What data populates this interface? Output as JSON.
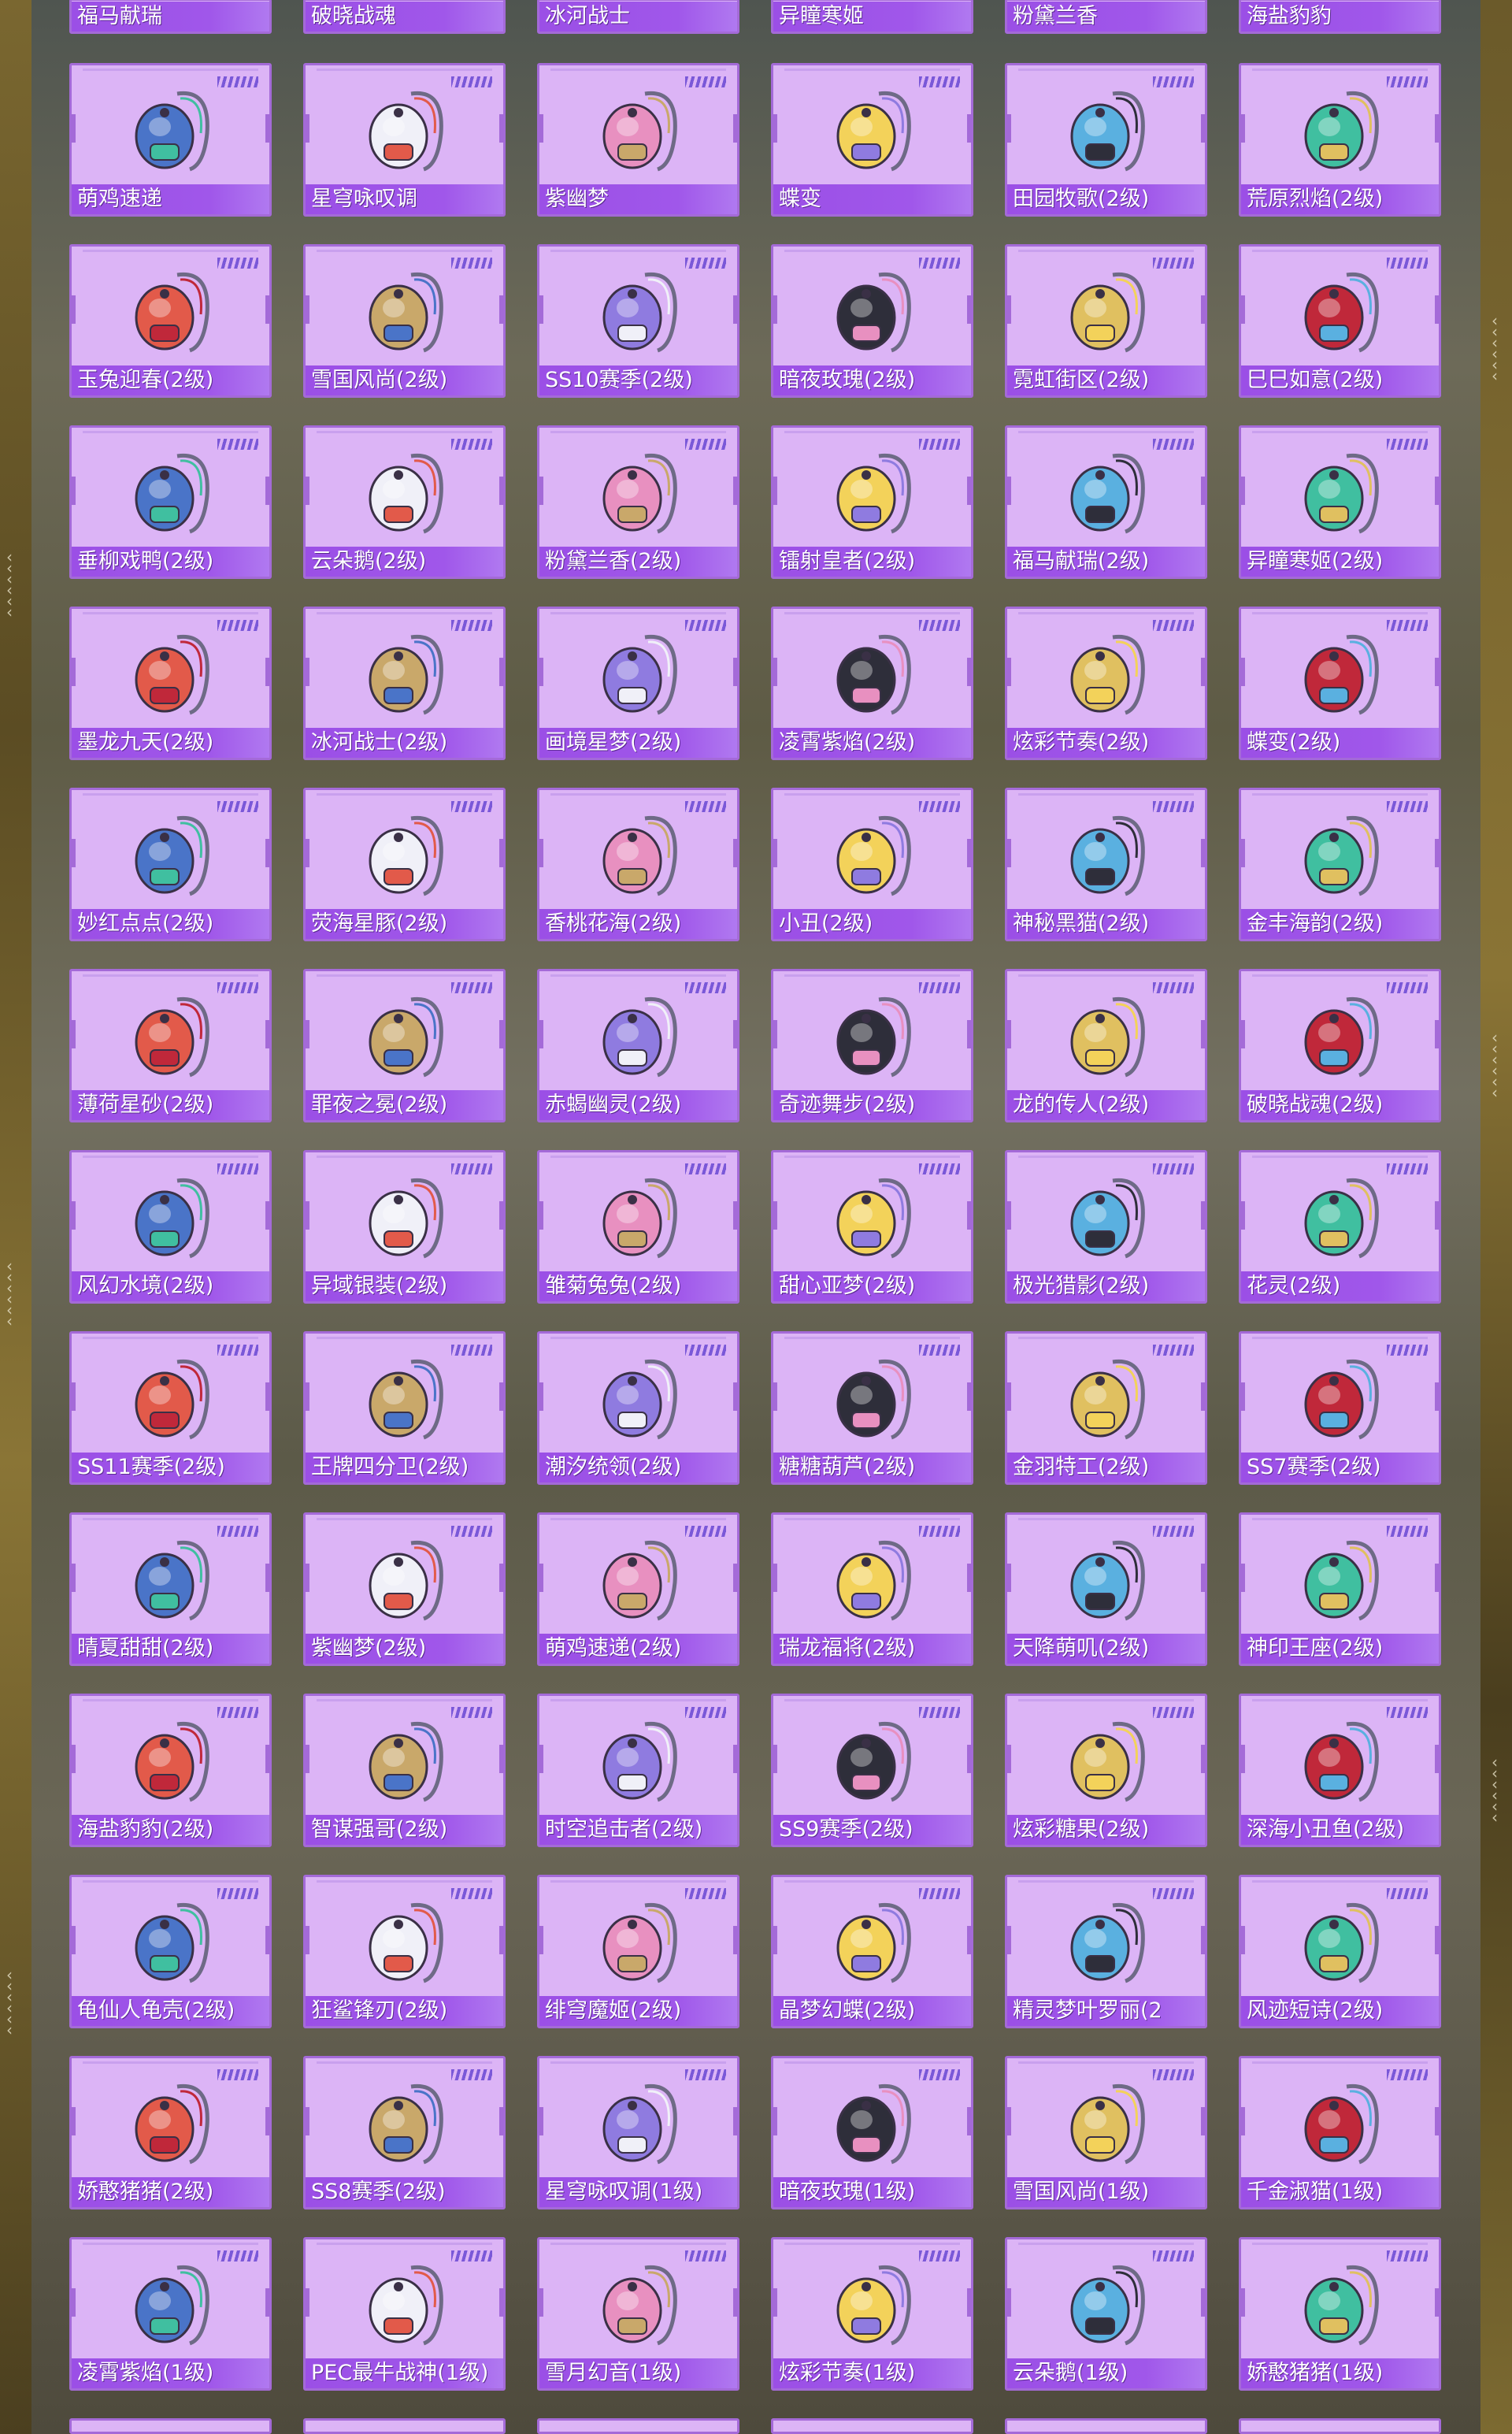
{
  "grid": {
    "rows": [
      [
        "福马献瑞",
        "破晓战魂",
        "冰河战士",
        "异瞳寒姬",
        "粉黛兰香",
        "海盐豹豹"
      ],
      [
        "萌鸡速递",
        "星穹咏叹调",
        "紫幽梦",
        "蝶变",
        "田园牧歌(2级)",
        "荒原烈焰(2级)"
      ],
      [
        "玉兔迎春(2级)",
        "雪国风尚(2级)",
        "SS10赛季(2级)",
        "暗夜玫瑰(2级)",
        "霓虹街区(2级)",
        "巳巳如意(2级)"
      ],
      [
        "垂柳戏鸭(2级)",
        "云朵鹅(2级)",
        "粉黛兰香(2级)",
        "镭射皇者(2级)",
        "福马献瑞(2级)",
        "异瞳寒姬(2级)"
      ],
      [
        "墨龙九天(2级)",
        "冰河战士(2级)",
        "画境星梦(2级)",
        "凌霄紫焰(2级)",
        "炫彩节奏(2级)",
        "蝶变(2级)"
      ],
      [
        "妙红点点(2级)",
        "荧海星豚(2级)",
        "香桃花海(2级)",
        "小丑(2级)",
        "神秘黑猫(2级)",
        "金丰海韵(2级)"
      ],
      [
        "薄荷星砂(2级)",
        "罪夜之冕(2级)",
        "赤蝎幽灵(2级)",
        "奇迹舞步(2级)",
        "龙的传人(2级)",
        "破晓战魂(2级)"
      ],
      [
        "风幻水境(2级)",
        "异域银装(2级)",
        "雏菊兔兔(2级)",
        "甜心亚梦(2级)",
        "极光猎影(2级)",
        "花灵(2级)"
      ],
      [
        "SS11赛季(2级)",
        "王牌四分卫(2级)",
        "潮汐统领(2级)",
        "糖糖葫芦(2级)",
        "金羽特工(2级)",
        "SS7赛季(2级)"
      ],
      [
        "晴夏甜甜(2级)",
        "紫幽梦(2级)",
        "萌鸡速递(2级)",
        "瑞龙福将(2级)",
        "天降萌叽(2级)",
        "神印王座(2级)"
      ],
      [
        "海盐豹豹(2级)",
        "智谋强哥(2级)",
        "时空追击者(2级)",
        "SS9赛季(2级)",
        "炫彩糖果(2级)",
        "深海小丑鱼(2级)"
      ],
      [
        "龟仙人龟壳(2级)",
        "狂鲨锋刃(2级)",
        "绯穹魔姬(2级)",
        "晶梦幻蝶(2级)",
        "精灵梦叶罗丽(2",
        "风迹短诗(2级)"
      ],
      [
        "娇憨猪猪(2级)",
        "SS8赛季(2级)",
        "星穹咏叹调(1级)",
        "暗夜玫瑰(1级)",
        "雪国风尚(1级)",
        "千金淑猫(1级)"
      ],
      [
        "凌霄紫焰(1级)",
        "PEC最牛战神(1级)",
        "雪月幻音(1级)",
        "炫彩节奏(1级)",
        "云朵鹅(1级)",
        "娇憨猪猪(1级)"
      ]
    ],
    "icons": [
      [
        "backpack-icon",
        "backpack-icon",
        "backpack-icon",
        "backpack-icon",
        "backpack-icon",
        "backpack-icon"
      ],
      [
        "chick-backpack-icon",
        "ornate-backpack-icon",
        "purple-orb-backpack-icon",
        "black-bow-backpack-icon",
        "basket-backpack-icon",
        "red-fox-backpack-icon"
      ],
      [
        "red-backpack-icon",
        "white-bunny-backpack-icon",
        "denim-backpack-icon",
        "bunny-doll-backpack-icon",
        "pink-backpack-icon",
        "white-snake-backpack-icon"
      ],
      [
        "duck-backpack-icon",
        "cloud-goose-backpack-icon",
        "pink-bag-backpack-icon",
        "laser-backpack-icon",
        "red-horse-backpack-icon",
        "blue-black-backpack-icon"
      ],
      [
        "dragon-orb-backpack-icon",
        "blue-backpack-icon",
        "book-backpack-icon",
        "orb-backpack-icon",
        "colorful-backpack-icon",
        "black-bow-backpack-icon"
      ],
      [
        "red-dot-backpack-icon",
        "dolphin-backpack-icon",
        "peach-backpack-icon",
        "clown-backpack-icon",
        "black-cat-backpack-icon",
        "gourd-backpack-icon"
      ],
      [
        "mint-backpack-icon",
        "dark-knight-backpack-icon",
        "scorpion-backpack-icon",
        "dance-backpack-icon",
        "red-dragon-backpack-icon",
        "black-red-backpack-icon"
      ],
      [
        "water-orb-backpack-icon",
        "silver-backpack-icon",
        "daisy-backpack-icon",
        "cat-bag-backpack-icon",
        "aurora-backpack-icon",
        "green-sprite-backpack-icon"
      ],
      [
        "ice-backpack-icon",
        "purple-shield-backpack-icon",
        "tide-backpack-icon",
        "candy-backpack-icon",
        "gold-agent-backpack-icon",
        "blue-season-backpack-icon"
      ],
      [
        "pink-bunny-backpack-icon",
        "purple-bunny-backpack-icon",
        "chick-backpack-icon",
        "dragon-armor-backpack-icon",
        "yellow-backpack-icon",
        "throne-backpack-icon"
      ],
      [
        "seal-backpack-icon",
        "bear-backpack-icon",
        "red-chaser-backpack-icon",
        "season9-backpack-icon",
        "candy-jar-backpack-icon",
        "clownfish-backpack-icon"
      ],
      [
        "turtle-shell-backpack-icon",
        "shark-backpack-icon",
        "demon-backpack-icon",
        "butterfly-backpack-icon",
        "fairy-backpack-icon",
        "poem-backpack-icon"
      ],
      [
        "pig-backpack-icon",
        "navy-backpack-icon",
        "golden-mask-backpack-icon",
        "rose-doll-backpack-icon",
        "snow-bunny-backpack-icon",
        "cat-backpack-icon"
      ],
      [
        "bunny-orb-backpack-icon",
        "guitar-backpack-icon",
        "moon-backpack-icon",
        "rainbow-backpack-icon",
        "flower-backpack-icon",
        "pig-bunny-backpack-icon"
      ]
    ]
  },
  "colors": {
    "card_bg": "#dcb4f6",
    "card_border": "#a46ad8",
    "label_bg": "#9b4fe6",
    "stripes": "#7a58d8"
  }
}
